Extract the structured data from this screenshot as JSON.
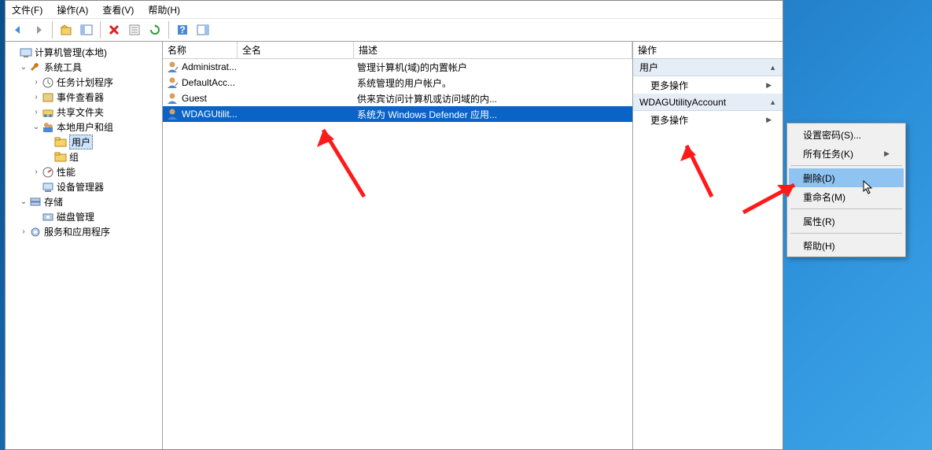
{
  "menu": {
    "file": "文件(F)",
    "action": "操作(A)",
    "view": "查看(V)",
    "help": "帮助(H)"
  },
  "tree": {
    "root": "计算机管理(本地)",
    "system_tools": "系统工具",
    "task_scheduler": "任务计划程序",
    "event_viewer": "事件查看器",
    "shared_folders": "共享文件夹",
    "local_users": "本地用户和组",
    "users": "用户",
    "groups": "组",
    "performance": "性能",
    "device_manager": "设备管理器",
    "storage": "存储",
    "disk_mgmt": "磁盘管理",
    "services_apps": "服务和应用程序"
  },
  "list": {
    "headers": {
      "name": "名称",
      "fullname": "全名",
      "desc": "描述"
    },
    "rows": [
      {
        "name": "Administrat...",
        "fullname": "",
        "desc": "管理计算机(域)的内置帐户"
      },
      {
        "name": "DefaultAcc...",
        "fullname": "",
        "desc": "系统管理的用户帐户。"
      },
      {
        "name": "Guest",
        "fullname": "",
        "desc": "供来宾访问计算机或访问域的内..."
      },
      {
        "name": "WDAGUtilit...",
        "fullname": "",
        "desc": "系统为 Windows Defender 应用..."
      }
    ],
    "selected_index": 3
  },
  "actions": {
    "title": "操作",
    "section1": "用户",
    "more": "更多操作",
    "section2": "WDAGUtilityAccount"
  },
  "context_menu": {
    "items": [
      {
        "label": "设置密码(S)...",
        "submenu": false
      },
      {
        "label": "所有任务(K)",
        "submenu": true
      },
      {
        "sep": true
      },
      {
        "label": "删除(D)",
        "submenu": false,
        "highlight": true
      },
      {
        "label": "重命名(M)",
        "submenu": false
      },
      {
        "sep": true
      },
      {
        "label": "属性(R)",
        "submenu": false
      },
      {
        "sep": true
      },
      {
        "label": "帮助(H)",
        "submenu": false
      }
    ]
  }
}
